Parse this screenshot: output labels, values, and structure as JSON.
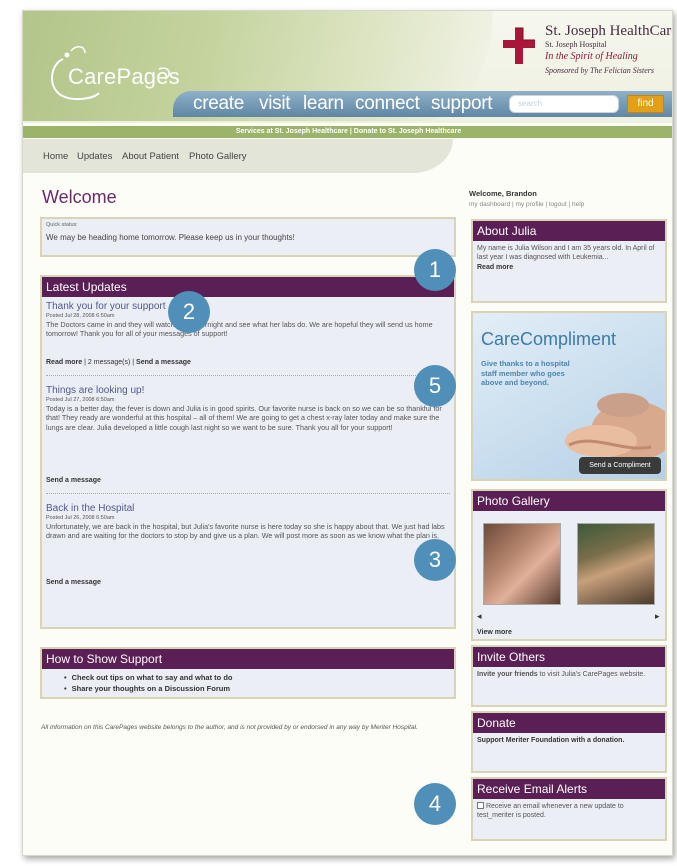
{
  "header": {
    "logo_text": "CarePages",
    "hospital_name": "St. Joseph HealthCare",
    "hospital_sub": "St. Joseph Hospital",
    "tagline": "In the Spirit of Healing",
    "sponsor": "Sponsored by The Felician Sisters",
    "nav": [
      "create",
      "visit",
      "learn",
      "connect",
      "support"
    ],
    "search_placeholder": "search",
    "find_label": "find",
    "services_bar": "Services at St. Joseph Healthcare | Donate to St. Joseph Healthcare"
  },
  "tabs": [
    "Home",
    "Updates",
    "About Patient",
    "Photo Gallery"
  ],
  "main": {
    "title": "Welcome",
    "quick_status_label": "Quick status:",
    "quick_status": "We may be heading home tomorrow. Please keep us in your thoughts!",
    "latest_updates_title": "Latest Updates",
    "updates": [
      {
        "title": "Thank you for your support",
        "date": "Posted Jul 28, 2008 6:50am",
        "body": "The Doctors came in and they will watch Julia overnight and see what her labs do. We are hopeful they will send us home tomorrow! Thank you for all of your messages of support!",
        "read_more": "Read more",
        "messages": "2 message(s)",
        "send": "Send a message"
      },
      {
        "title": "Things are looking up!",
        "date": "Posted Jul 27, 2008 6:50am",
        "body": "Today is a better day, the fever is down and Julia is in good spirits. Our favorite nurse is back on so we can be so thankful for that! They ready are wonderful at this hospital – all of them! We are going to get a chest x-ray later today and make sure the lungs are clear. Julia developed a little cough last night so we want to be sure. Thank you all for your support!",
        "send": "Send a message"
      },
      {
        "title": "Back in the Hospital",
        "date": "Posted Jul 26, 2008 6:50am",
        "body": "Unfortunately, we are back in the hospital, but Julia's favorite nurse is here today so she is happy about that. We just had labs drawn and are waiting for the doctors to stop by and give us a plan. We will post more as soon as we know what the plan is.",
        "send": "Send a message"
      }
    ],
    "support_title": "How to Show Support",
    "support_items": [
      "Check out tips on what to say and what to do",
      "Share your thoughts on a Discussion Forum"
    ],
    "disclaimer": "All information on this CarePages website belongs to the author, and is not provided by or endorsed in any way by Meriter Hospital."
  },
  "side": {
    "greeting": "Welcome, Brandon",
    "account_links": "my dashboard | my profile | logout | help",
    "about_title": "About Julia",
    "about_text": "My name is Julia Wilson and I am 35 years old. In April of last year I was diagnosed with Leukemia...",
    "about_more": "Read more",
    "promo_title": "CareCompliment",
    "promo_text": "Give thanks to a hospital staff member who goes above and beyond.",
    "promo_button": "Send a Compliment",
    "gallery_title": "Photo Gallery",
    "gallery_prev": "◂",
    "gallery_next": "▸",
    "gallery_more": "View more",
    "invite_title": "Invite Others",
    "invite_link": "Invite your friends",
    "invite_text": "to visit Julia's CarePages website.",
    "donate_title": "Donate",
    "donate_text": "Support Meriter Foundation with a donation.",
    "alerts_title": "Receive Email Alerts",
    "alerts_text": "Receive an email whenever a new update to test_meriter is posted."
  },
  "badges": [
    "1",
    "2",
    "3",
    "4",
    "5"
  ],
  "colors": {
    "purple": "#5a1f55",
    "nav_blue": "#6f93ae",
    "accent_orange": "#e3a017",
    "badge_blue": "#4f8fb8"
  }
}
